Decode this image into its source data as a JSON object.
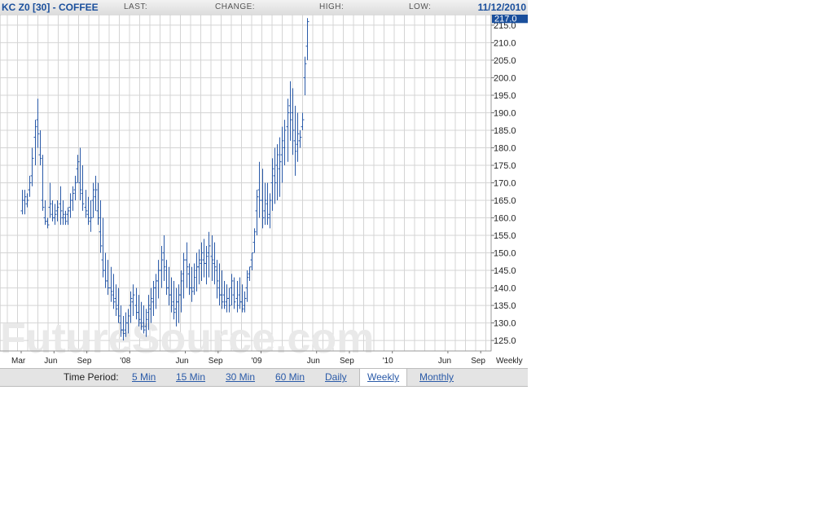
{
  "header": {
    "symbol": "KC Z0 [30] - COFFEE",
    "last_label": "LAST:",
    "change_label": "CHANGE:",
    "high_label": "HIGH:",
    "low_label": "LOW:",
    "date": "11/12/2010"
  },
  "watermark": "FutureSource.com",
  "colors": {
    "line": "#2a5aa8",
    "grid": "#d4d4d4",
    "last_price_bg": "#1a4f9c"
  },
  "chart_data": {
    "type": "line",
    "style": "weekly price bars (OHLC, shown as vertical high-low range bars)",
    "title": "KC Z0 [30] - COFFEE",
    "xlabel": "",
    "ylabel": "",
    "ylim": [
      122,
      218
    ],
    "yticks": [
      125,
      130,
      135,
      140,
      145,
      150,
      155,
      160,
      165,
      170,
      175,
      180,
      185,
      190,
      195,
      200,
      205,
      210,
      215
    ],
    "ytick_labels": [
      "125.0",
      "130.0",
      "135.0",
      "140.0",
      "145.0",
      "150.0",
      "155.0",
      "160.0",
      "165.0",
      "170.0",
      "175.0",
      "180.0",
      "185.0",
      "190.0",
      "195.0",
      "200.0",
      "205.0",
      "210.0",
      "215.0"
    ],
    "xticks": [
      {
        "label": "Mar",
        "week": 0
      },
      {
        "label": "Jun",
        "week": 13
      },
      {
        "label": "Sep",
        "week": 26
      },
      {
        "label": "'08",
        "week": 43
      },
      {
        "label": "Jun",
        "week": 65
      },
      {
        "label": "Sep",
        "week": 78
      },
      {
        "label": "'09",
        "week": 95
      },
      {
        "label": "Jun",
        "week": 117
      },
      {
        "label": "Sep",
        "week": 130
      },
      {
        "label": "'10",
        "week": 147
      },
      {
        "label": "Jun",
        "week": 169
      },
      {
        "label": "Sep",
        "week": 182
      }
    ],
    "x_period_label": "Weekly",
    "last_price": "217.0",
    "grid": true,
    "series": [
      {
        "high": [
          168,
          168,
          167,
          172,
          180,
          188,
          194,
          185,
          178,
          165,
          160,
          170,
          165,
          164,
          165,
          169,
          165,
          162,
          163,
          167,
          169,
          172,
          178,
          180,
          175,
          168,
          166,
          165,
          170,
          172,
          170,
          165,
          160,
          150,
          148,
          146,
          144,
          141,
          140,
          135,
          132,
          133,
          134,
          139,
          141,
          140,
          138,
          136,
          135,
          134,
          138,
          140,
          142,
          144,
          148,
          152,
          155,
          148,
          146,
          143,
          142,
          140,
          141,
          145,
          150,
          153,
          147,
          146,
          147,
          150,
          151,
          153,
          154,
          152,
          156,
          155,
          153,
          148,
          147,
          145,
          142,
          141,
          140,
          144,
          143,
          142,
          143,
          141,
          139,
          145,
          146,
          150,
          157,
          168,
          176,
          174,
          170,
          170,
          167,
          177,
          180,
          181,
          183,
          186,
          188,
          194,
          199,
          197,
          192,
          190,
          185,
          190,
          206,
          217
        ],
        "low": [
          161,
          161,
          163,
          166,
          169,
          175,
          180,
          175,
          162,
          158,
          157,
          160,
          159,
          158,
          159,
          158,
          158,
          158,
          158,
          160,
          162,
          165,
          170,
          165,
          162,
          160,
          158,
          156,
          160,
          162,
          158,
          150,
          143,
          140,
          138,
          136,
          134,
          132,
          130,
          126,
          125,
          126,
          127,
          130,
          132,
          131,
          129,
          128,
          127,
          126,
          128,
          130,
          132,
          134,
          137,
          140,
          142,
          138,
          135,
          133,
          131,
          129,
          130,
          133,
          137,
          140,
          138,
          136,
          138,
          139,
          141,
          142,
          143,
          141,
          143,
          142,
          141,
          137,
          135,
          134,
          134,
          133,
          133,
          135,
          134,
          133,
          134,
          133,
          133,
          136,
          142,
          145,
          150,
          155,
          160,
          157,
          158,
          158,
          157,
          162,
          164,
          165,
          166,
          170,
          175,
          176,
          182,
          178,
          172,
          176,
          180,
          185,
          195,
          205
        ],
        "open": [
          162,
          165,
          164,
          168,
          172,
          183,
          188,
          178,
          165,
          160,
          159,
          163,
          161,
          160,
          162,
          164,
          160,
          160,
          161,
          163,
          165,
          168,
          174,
          170,
          167,
          163,
          161,
          159,
          165,
          166,
          162,
          156,
          148,
          145,
          142,
          140,
          138,
          137,
          135,
          130,
          128,
          128,
          130,
          135,
          136,
          135,
          133,
          130,
          130,
          129,
          133,
          134,
          136,
          140,
          142,
          145,
          150,
          145,
          140,
          138,
          136,
          134,
          136,
          138,
          144,
          148,
          144,
          140,
          140,
          145,
          146,
          147,
          148,
          147,
          150,
          149,
          147,
          145,
          140,
          138,
          138,
          136,
          137,
          140,
          138,
          137,
          138,
          136,
          135,
          140,
          144,
          148,
          153,
          162,
          168,
          165,
          162,
          164,
          161,
          170,
          172,
          175,
          174,
          178,
          180,
          186,
          192,
          190,
          182,
          181,
          182,
          186,
          200,
          209
        ],
        "close": [
          165,
          166,
          165,
          170,
          177,
          186,
          184,
          177,
          163,
          159,
          158,
          164,
          160,
          161,
          163,
          162,
          161,
          159,
          162,
          165,
          167,
          170,
          176,
          168,
          164,
          162,
          160,
          160,
          168,
          168,
          160,
          152,
          145,
          142,
          140,
          139,
          136,
          134,
          132,
          128,
          127,
          130,
          132,
          137,
          138,
          133,
          131,
          129,
          128,
          131,
          135,
          137,
          140,
          142,
          145,
          148,
          146,
          140,
          138,
          135,
          133,
          136,
          138,
          142,
          148,
          146,
          140,
          139,
          143,
          146,
          148,
          150,
          147,
          149,
          152,
          148,
          146,
          142,
          138,
          136,
          135,
          137,
          135,
          142,
          136,
          135,
          136,
          134,
          137,
          143,
          146,
          150,
          156,
          166,
          165,
          160,
          165,
          160,
          165,
          174,
          170,
          178,
          176,
          182,
          185,
          190,
          188,
          185,
          179,
          184,
          183,
          188,
          204,
          216
        ]
      }
    ]
  },
  "time_period": {
    "label": "Time Period:",
    "options": [
      {
        "label": "5 Min",
        "active": false
      },
      {
        "label": "15 Min",
        "active": false
      },
      {
        "label": "30 Min",
        "active": false
      },
      {
        "label": "60 Min",
        "active": false
      },
      {
        "label": "Daily",
        "active": false
      },
      {
        "label": "Weekly",
        "active": true
      },
      {
        "label": "Monthly",
        "active": false
      }
    ]
  }
}
